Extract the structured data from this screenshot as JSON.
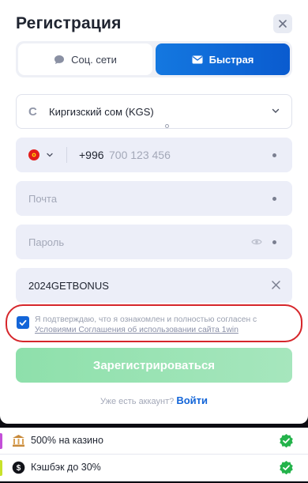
{
  "header": {
    "title": "Регистрация"
  },
  "tabs": [
    {
      "label": "Соц. сети",
      "icon": "chat-bubble-icon",
      "active": false
    },
    {
      "label": "Быстрая",
      "icon": "envelope-icon",
      "active": true
    }
  ],
  "form": {
    "currency": {
      "symbol": "С",
      "value": "Киргизский сом (KGS)"
    },
    "phone": {
      "code": "+996",
      "placeholder": "700 123 456",
      "flag_color": "#e31d1c"
    },
    "email": {
      "placeholder": "Почта"
    },
    "password": {
      "placeholder": "Пароль"
    },
    "promo": {
      "value": "2024GETBONUS"
    },
    "consent": {
      "checked": true,
      "text": "Я подтверждаю, что я ознакомлен и полностью согласен с",
      "link": "Условиями Соглашения об использовании сайта 1win"
    },
    "submit_label": "Зарегистрироваться"
  },
  "login": {
    "prompt": "Уже есть аккаунт?",
    "link": "Войти"
  },
  "bonuses": [
    {
      "label": "500% на казино",
      "stripe": "#c34fd8"
    },
    {
      "label": "Кэшбэк до 30%",
      "stripe": "#c8e22a"
    }
  ],
  "colors": {
    "accent": "#1365d8",
    "submit": "#8ee0ab",
    "highlight": "#d6262b",
    "ok": "#24b34b"
  }
}
